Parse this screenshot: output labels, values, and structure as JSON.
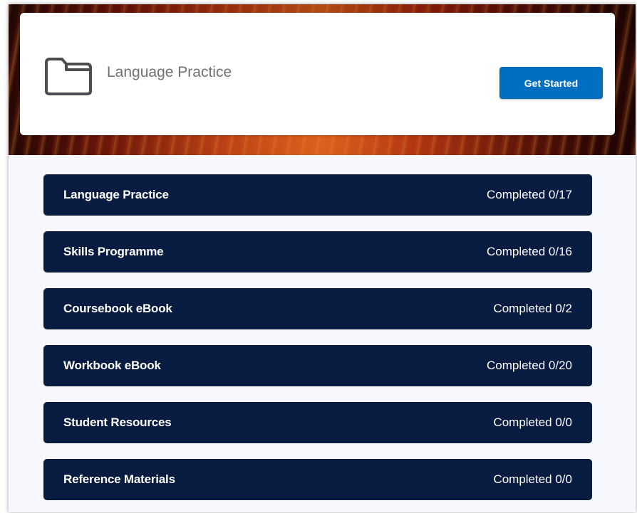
{
  "header": {
    "title": "Language Practice",
    "cta_label": "Get Started",
    "icon": "folder-icon"
  },
  "colors": {
    "module_background": "#071c40",
    "cta_background": "#006fbf",
    "page_background": "#f6f8fd"
  },
  "modules": [
    {
      "title": "Language Practice",
      "status": "Completed 0/17"
    },
    {
      "title": "Skills Programme",
      "status": "Completed 0/16"
    },
    {
      "title": "Coursebook eBook",
      "status": "Completed 0/2"
    },
    {
      "title": "Workbook eBook",
      "status": "Completed 0/20"
    },
    {
      "title": "Student Resources",
      "status": "Completed 0/0"
    },
    {
      "title": "Reference Materials",
      "status": "Completed 0/0"
    }
  ]
}
